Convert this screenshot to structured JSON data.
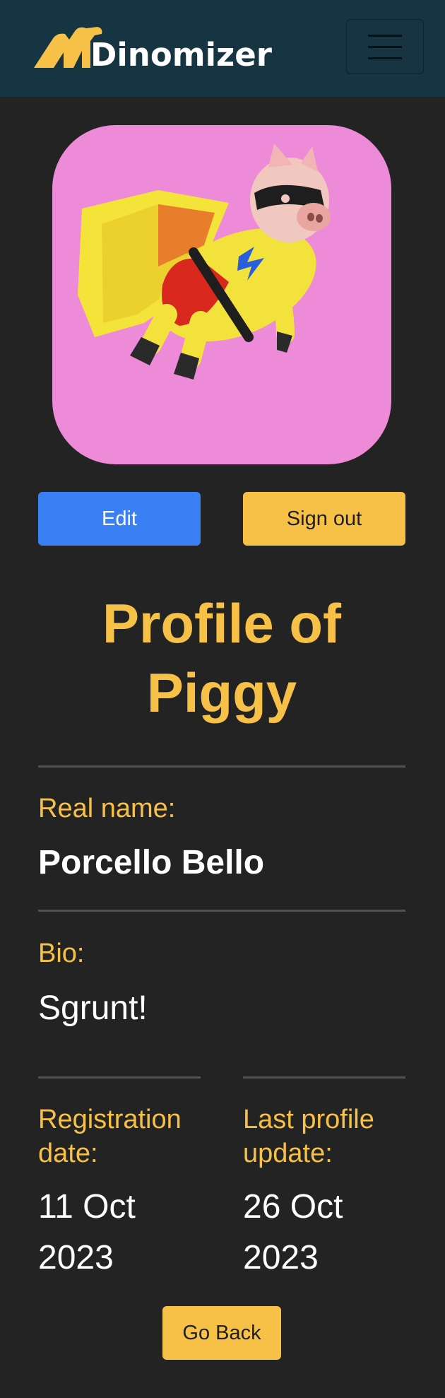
{
  "navbar": {
    "brand_name": "Dinomizer",
    "toggler_icon": "hamburger-menu-icon",
    "brand_color": "#173442"
  },
  "profile": {
    "avatar_icon": "superhero-pig-avatar",
    "avatar_bg": "#ee8bd8",
    "edit_label": "Edit",
    "signout_label": "Sign out",
    "title_line1": "Profile of",
    "title_line2": "Piggy",
    "real_name_label": "Real name:",
    "real_name": "Porcello Bello",
    "bio_label": "Bio:",
    "bio": "Sgrunt!",
    "registration_label_line1": "Registration",
    "registration_label_line2": "date:",
    "registration_date_line1": "11 Oct",
    "registration_date_line2": "2023",
    "last_update_label_line1": "Last profile",
    "last_update_label_line2": "update:",
    "last_update_date_line1": "26 Oct",
    "last_update_date_line2": "2023",
    "back_label": "Go Back"
  },
  "colors": {
    "background": "#232323",
    "accent_yellow": "#f7c147",
    "primary_blue": "#3b7ff5"
  }
}
